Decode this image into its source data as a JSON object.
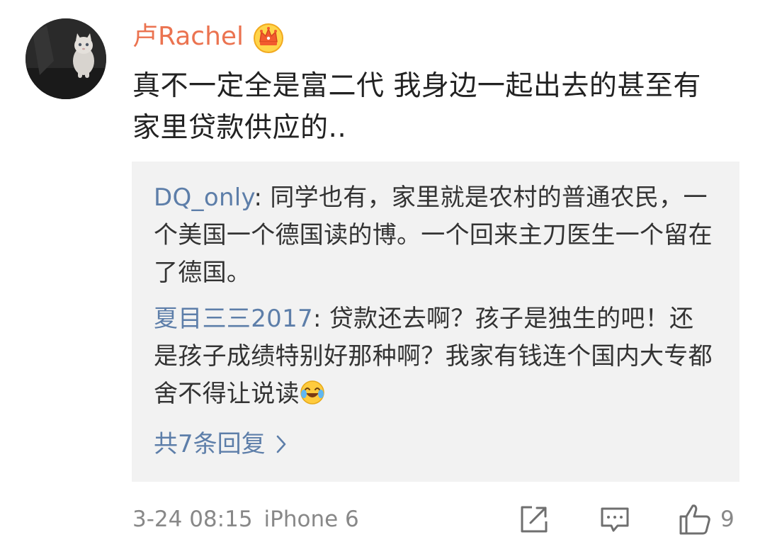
{
  "comment": {
    "username": "卢Rachel",
    "text": "真不一定全是富二代 我身边一起出去的甚至有家里贷款供应的..",
    "timestamp": "3-24 08:15",
    "device": "iPhone 6",
    "like_count": "9"
  },
  "replies": [
    {
      "author": "DQ_only",
      "separator": ": ",
      "text": "同学也有，家里就是农村的普通农民，一个美国一个德国读的博。一个回来主刀医生一个留在了德国。"
    },
    {
      "author": "夏目三三2017",
      "separator": ": ",
      "text": "贷款还去啊？孩子是独生的吧！还是孩子成绩特别好那种啊？我家有钱连个国内大专都舍不得让说读"
    }
  ],
  "more_replies": {
    "label": "共7条回复"
  },
  "icons": {
    "avatar": "kitten-photo",
    "badge": "crown-icon",
    "emoji": "laugh-cry-emoji",
    "more": "chevron-right-icon",
    "share": "share-icon",
    "comment": "comment-icon",
    "like": "thumbs-up-icon"
  },
  "colors": {
    "username": "#eb7350",
    "link": "#5d7ea9",
    "reply_background": "#f2f2f2",
    "meta": "#888888"
  }
}
